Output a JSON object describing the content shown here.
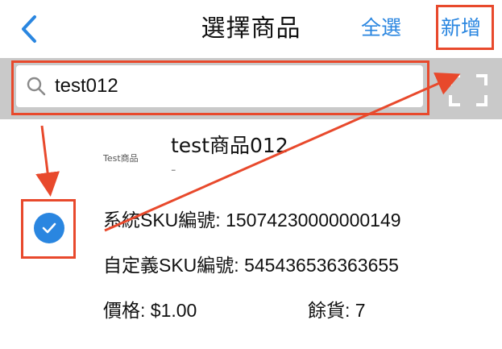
{
  "header": {
    "title": "選擇商品",
    "select_all_label": "全選",
    "add_label": "新增"
  },
  "search": {
    "value": "test012"
  },
  "product": {
    "thumbnail_text": "Test商品",
    "name": "test商品012",
    "subtitle": "-",
    "sku_system_label": "系統SKU編號:",
    "sku_system_value": "15074230000000149",
    "sku_custom_label": "自定義SKU編號:",
    "sku_custom_value": "545436536363655",
    "price_label": "價格:",
    "price_value": "$1.00",
    "stock_label": "餘貨:",
    "stock_value": "7",
    "selected": true
  },
  "colors": {
    "accent": "#2a86e0",
    "annotation": "#e8492c",
    "search_bar_bg": "#c9c9c9"
  },
  "icons": [
    "back-chevron-icon",
    "search-icon",
    "scan-icon",
    "checkmark-icon"
  ]
}
